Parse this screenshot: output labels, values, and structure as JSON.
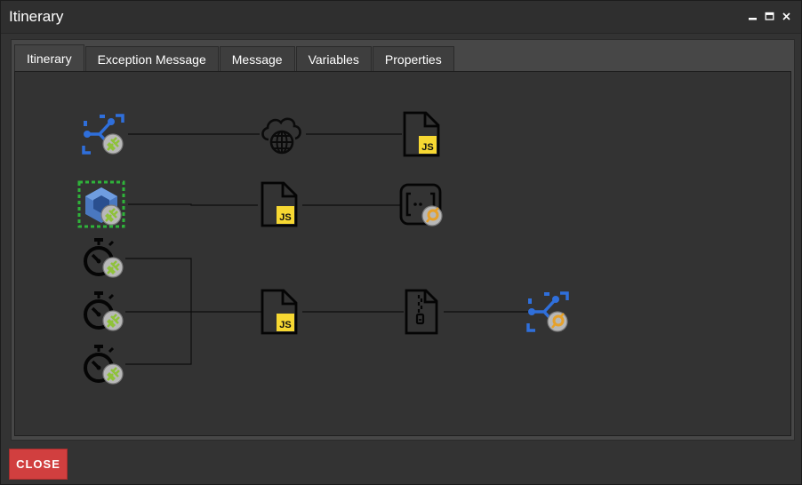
{
  "window": {
    "title": "Itinerary"
  },
  "tabs": [
    {
      "label": "Itinerary",
      "active": true
    },
    {
      "label": "Exception Message",
      "active": false
    },
    {
      "label": "Message",
      "active": false
    },
    {
      "label": "Variables",
      "active": false
    },
    {
      "label": "Properties",
      "active": false
    }
  ],
  "nodes": {
    "row1": [
      "eventhub-adapter-icon",
      "cloud-globe-icon",
      "javascript-file-icon"
    ],
    "row2": [
      "cube-service-icon",
      "javascript-file-icon",
      "json-array-adapter-icon"
    ],
    "row3": [
      "stopwatch-adapter-icon",
      "stopwatch-adapter-icon",
      "stopwatch-adapter-icon",
      "javascript-file-icon",
      "zip-file-icon",
      "eventhub-adapter-icon"
    ]
  },
  "js_badge": "JS",
  "footer": {
    "close_label": "CLOSE"
  },
  "colors": {
    "close_button": "#d13f3f",
    "selected_outline": "#2fb33a",
    "js_yellow": "#f7d832",
    "azure_blue": "#2f6fdb",
    "adapter_green": "#8fc23a",
    "adapter_orange": "#e6a12b"
  }
}
